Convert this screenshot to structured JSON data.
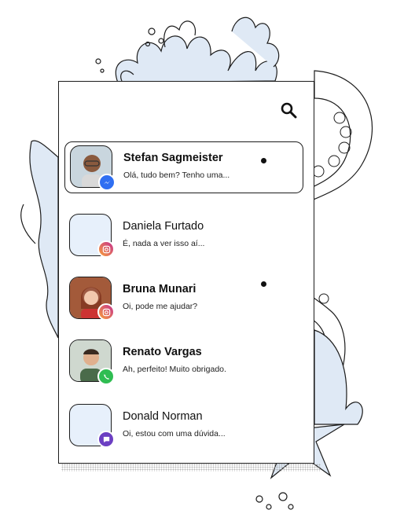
{
  "search": {
    "icon": "search-icon"
  },
  "conversations": [
    {
      "name": "Stefan Sagmeister",
      "preview": "Olá, tudo bem? Tenho uma...",
      "app": "messenger-icon",
      "bold": true,
      "selected": true
    },
    {
      "name": "Daniela Furtado",
      "preview": "É, nada a ver isso aí...",
      "app": "instagram-icon",
      "bold": false,
      "selected": false
    },
    {
      "name": "Bruna Munari",
      "preview": "Oi, pode me ajudar?",
      "app": "instagram-icon",
      "bold": true,
      "selected": false
    },
    {
      "name": "Renato Vargas",
      "preview": "Ah, perfeito! Muito obrigado.",
      "app": "whatsapp-icon",
      "bold": true,
      "selected": false
    },
    {
      "name": "Donald Norman",
      "preview": "Oi, estou com uma dúvida...",
      "app": "chat-icon",
      "bold": false,
      "selected": false
    }
  ],
  "colors": {
    "ink": "#1c1c1c",
    "avatar_placeholder": "#e7f0fb",
    "messenger": "#2f6ff2",
    "instagram_start": "#f9a13a",
    "instagram_end": "#c5308e",
    "whatsapp": "#2fbd52",
    "chat": "#6c3fc2",
    "illustration_fill": "#dfe9f5"
  }
}
